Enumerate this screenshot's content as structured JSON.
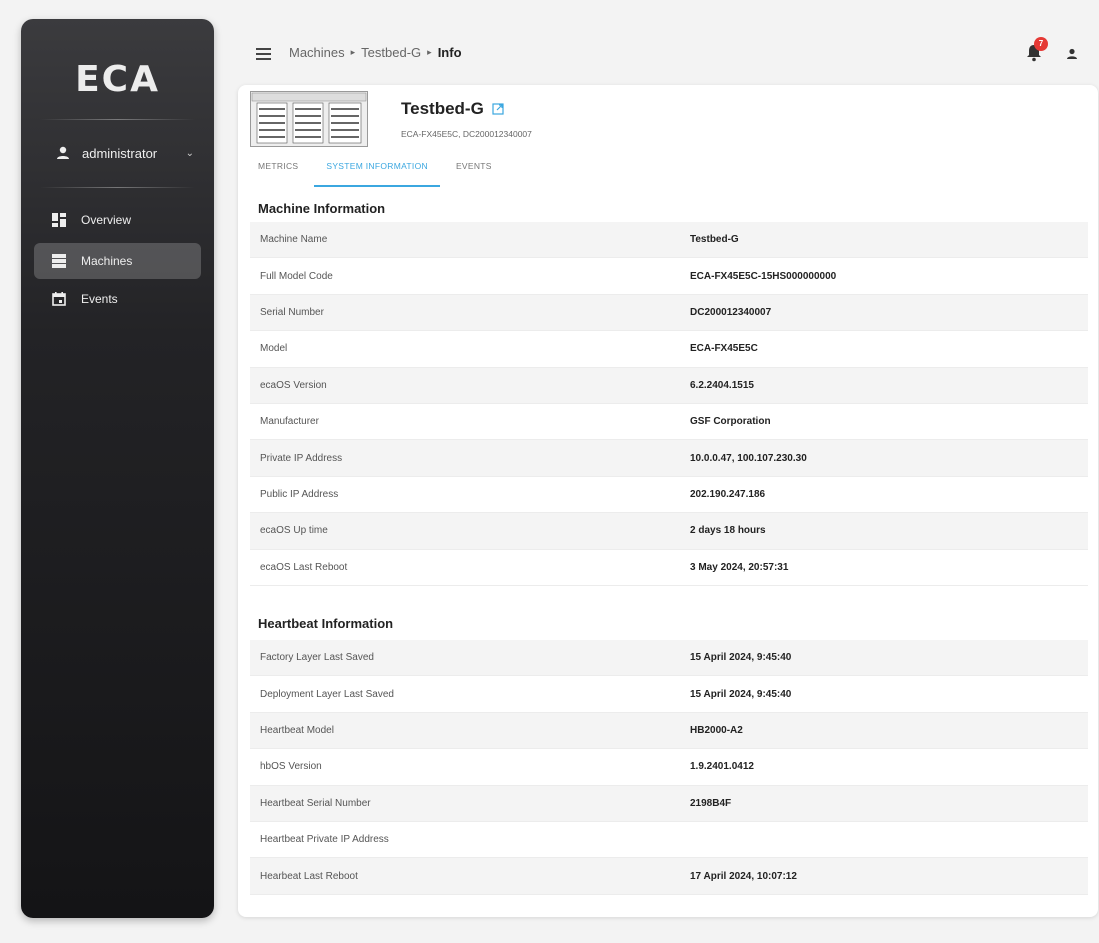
{
  "sidebar": {
    "logo": "ECA",
    "user": "administrator",
    "items": [
      {
        "label": "Overview",
        "icon": "dashboard-icon"
      },
      {
        "label": "Machines",
        "icon": "server-icon"
      },
      {
        "label": "Events",
        "icon": "calendar-icon"
      }
    ]
  },
  "header": {
    "breadcrumb": [
      "Machines",
      "Testbed-G",
      "Info"
    ],
    "notification_count": "7"
  },
  "machine": {
    "name": "Testbed-G",
    "subtitle": "ECA-FX45E5C, DC200012340007"
  },
  "tabs": [
    "METRICS",
    "SYSTEM INFORMATION",
    "EVENTS"
  ],
  "machine_info": {
    "title": "Machine Information",
    "rows": [
      {
        "label": "Machine Name",
        "value": "Testbed-G"
      },
      {
        "label": "Full Model Code",
        "value": "ECA-FX45E5C-15HS000000000"
      },
      {
        "label": "Serial Number",
        "value": "DC200012340007"
      },
      {
        "label": "Model",
        "value": "ECA-FX45E5C"
      },
      {
        "label": "ecaOS Version",
        "value": "6.2.2404.1515"
      },
      {
        "label": "Manufacturer",
        "value": "GSF Corporation"
      },
      {
        "label": "Private IP Address",
        "value": "10.0.0.47, 100.107.230.30"
      },
      {
        "label": "Public IP Address",
        "value": "202.190.247.186"
      },
      {
        "label": "ecaOS Up time",
        "value": "2 days 18 hours"
      },
      {
        "label": "ecaOS Last Reboot",
        "value": "3 May 2024, 20:57:31"
      }
    ]
  },
  "heartbeat_info": {
    "title": "Heartbeat Information",
    "rows": [
      {
        "label": "Factory Layer Last Saved",
        "value": "15 April 2024, 9:45:40"
      },
      {
        "label": "Deployment Layer Last Saved",
        "value": "15 April 2024, 9:45:40"
      },
      {
        "label": "Heartbeat Model",
        "value": "HB2000-A2"
      },
      {
        "label": "hbOS Version",
        "value": "1.9.2401.0412"
      },
      {
        "label": "Heartbeat Serial Number",
        "value": "2198B4F"
      },
      {
        "label": "Heartbeat Private IP Address",
        "value": ""
      },
      {
        "label": "Hearbeat Last Reboot",
        "value": "17 April 2024, 10:07:12"
      }
    ]
  },
  "colors": {
    "accent": "#3ba7e0",
    "badge": "#e53935"
  }
}
